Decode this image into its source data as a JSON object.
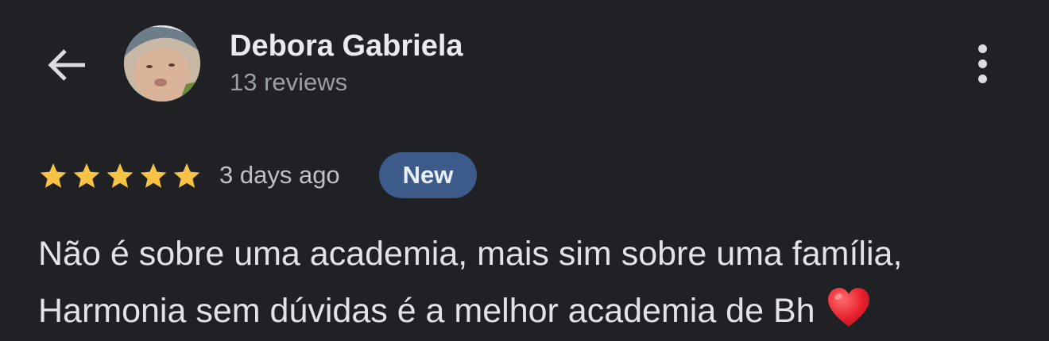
{
  "header": {
    "back_icon": "arrow-back-icon",
    "reviewer_name": "Debora Gabriela",
    "review_count": "13 reviews",
    "more_icon": "more-vert-icon"
  },
  "review": {
    "rating": 5,
    "rating_max": 5,
    "star_color": "#f6c344",
    "date": "3 days ago",
    "badge": "New",
    "badge_color": "#3c5a8a",
    "text_lines": [
      "Não é sobre uma academia, mais sim sobre uma família,",
      "Harmonia sem dúvidas é a melhor academia de Bh"
    ],
    "emoji_icon": "red-heart-icon"
  },
  "colors": {
    "background": "#202124",
    "primary_text": "#e8eaed",
    "secondary_text": "#9aa0a6"
  }
}
